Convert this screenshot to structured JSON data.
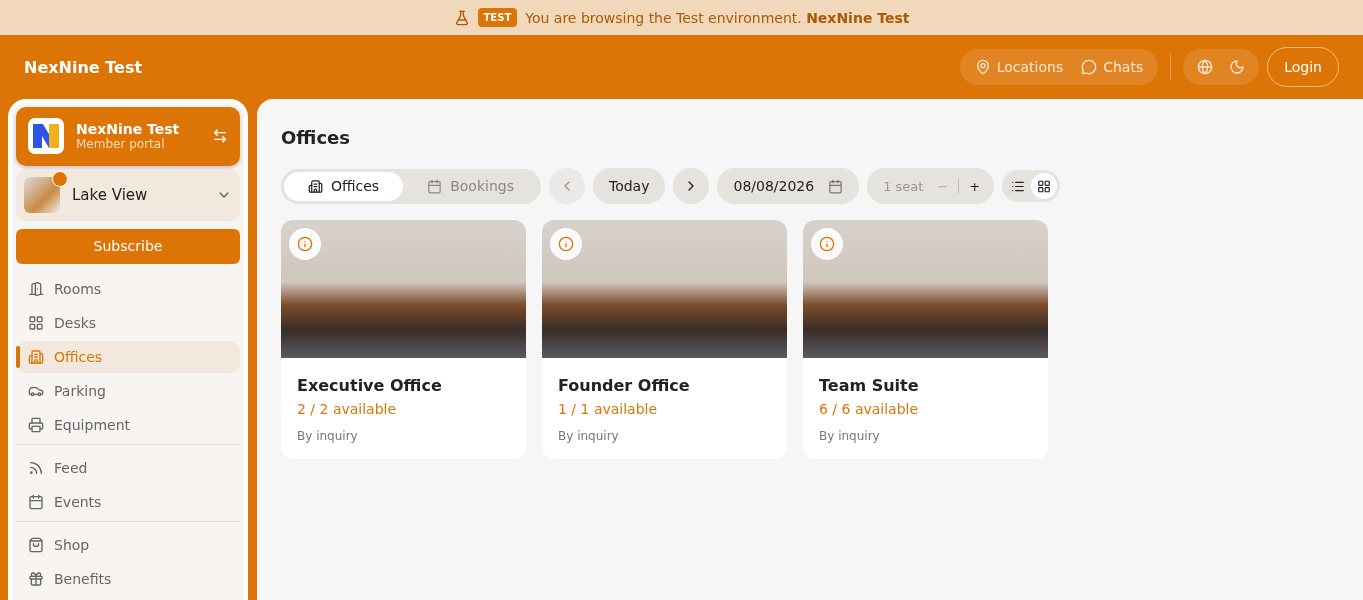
{
  "banner": {
    "badge": "TEST",
    "text": "You are browsing the Test environment. **NexNine Test**"
  },
  "header": {
    "brand": "NexNine Test",
    "links": [
      {
        "label": "Locations",
        "kind": "pin"
      },
      {
        "label": "Chats",
        "kind": "chat"
      }
    ],
    "login": "Login"
  },
  "sidebar": {
    "org": {
      "name": "NexNine Test",
      "subtitle": "Member portal"
    },
    "location": {
      "name": "Lake View"
    },
    "subscribe": "Subscribe",
    "nav_groups": [
      [
        {
          "label": "Rooms",
          "kind": "door",
          "selected": false
        },
        {
          "label": "Desks",
          "kind": "grid",
          "selected": false
        },
        {
          "label": "Offices",
          "kind": "building",
          "selected": true
        },
        {
          "label": "Parking",
          "kind": "car",
          "selected": false
        },
        {
          "label": "Equipment",
          "kind": "printer",
          "selected": false
        }
      ],
      [
        {
          "label": "Feed",
          "kind": "rss",
          "selected": false
        },
        {
          "label": "Events",
          "kind": "calendar",
          "selected": false
        }
      ],
      [
        {
          "label": "Shop",
          "kind": "bag",
          "selected": false
        },
        {
          "label": "Benefits",
          "kind": "gift",
          "selected": false
        }
      ]
    ]
  },
  "page": {
    "title": "Offices",
    "tabs": [
      {
        "label": "Offices",
        "kind": "building",
        "selected": true
      },
      {
        "label": "Bookings",
        "kind": "calendar",
        "selected": false
      }
    ],
    "today": "Today",
    "date": "08/08/2026",
    "seats": "1 seat",
    "minus": "−",
    "plus": "+",
    "views": [
      {
        "kind": "list",
        "selected": false
      },
      {
        "kind": "grid",
        "selected": true
      }
    ],
    "cards": [
      {
        "name": "Executive Office",
        "availability": "2 / 2 available",
        "price": "By inquiry"
      },
      {
        "name": "Founder Office",
        "availability": "1 / 1 available",
        "price": "By inquiry"
      },
      {
        "name": "Team Suite",
        "availability": "6 / 6 available",
        "price": "By inquiry"
      }
    ]
  }
}
